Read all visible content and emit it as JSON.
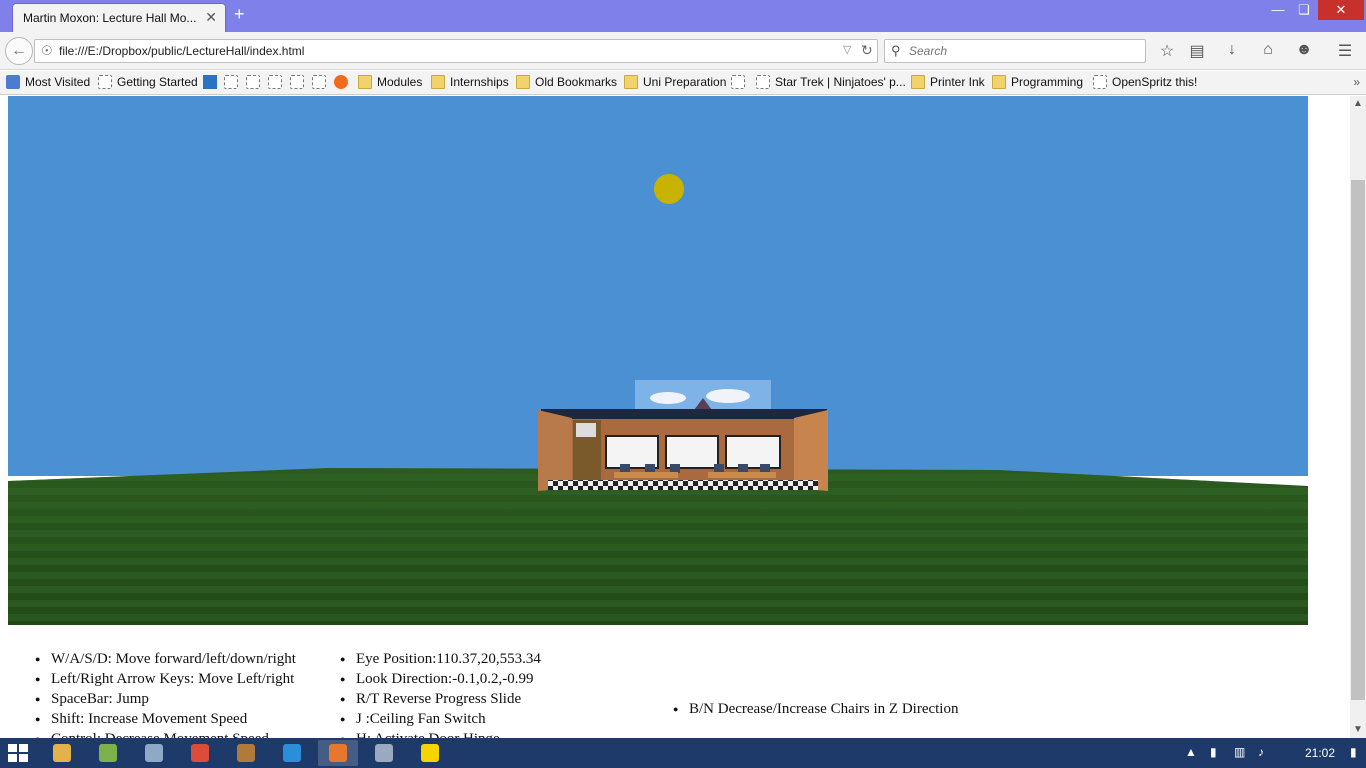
{
  "browser": {
    "tab_title": "Martin Moxon: Lecture Hall Mo...",
    "url": "file:///E:/Dropbox/public/LectureHall/index.html",
    "search_placeholder": "Search"
  },
  "bookmarks": [
    {
      "label": "Most Visited",
      "icon": "visited"
    },
    {
      "label": "Getting Started",
      "icon": "page"
    },
    {
      "label": "",
      "icon": "outlook"
    },
    {
      "label": "",
      "icon": "page"
    },
    {
      "label": "",
      "icon": "page"
    },
    {
      "label": "",
      "icon": "page"
    },
    {
      "label": "",
      "icon": "page"
    },
    {
      "label": "",
      "icon": "page"
    },
    {
      "label": "",
      "icon": "fire"
    },
    {
      "label": "Modules",
      "icon": "folder"
    },
    {
      "label": "Internships",
      "icon": "folder"
    },
    {
      "label": "Old Bookmarks",
      "icon": "folder"
    },
    {
      "label": "Uni Preparation",
      "icon": "folder"
    },
    {
      "label": "",
      "icon": "page"
    },
    {
      "label": "Star Trek | Ninjatoes' p...",
      "icon": "page"
    },
    {
      "label": "Printer Ink",
      "icon": "folder"
    },
    {
      "label": "Programming",
      "icon": "folder"
    },
    {
      "label": "OpenSpritz this!",
      "icon": "page"
    }
  ],
  "scene": {
    "sky_color": "#4a90d2",
    "grass_color": "#2f5e22",
    "sun_color": "#c8b400"
  },
  "help": {
    "col1": [
      "W/A/S/D: Move forward/left/down/right",
      "Left/Right Arrow Keys: Move Left/right",
      "SpaceBar: Jump",
      "Shift: Increase Movement Speed",
      "Control: Decrease Movement Speed"
    ],
    "col2": [
      "Eye Position:110.37,20,553.34",
      "Look Direction:-0.1,0.2,-0.99",
      "R/T Reverse Progress Slide",
      "J :Ceiling Fan Switch",
      "H: Activate Door Hinge"
    ],
    "col3": [
      "B/N Decrease/Increase Chairs in Z Direction"
    ]
  },
  "taskbar": {
    "time": "21:02",
    "apps": [
      {
        "name": "file-explorer",
        "color": "#e3b24a"
      },
      {
        "name": "notepad",
        "color": "#7db24a"
      },
      {
        "name": "remote-desktop",
        "color": "#8fa8c8"
      },
      {
        "name": "chrome",
        "color": "#dd4b39"
      },
      {
        "name": "terminal",
        "color": "#b07a3a"
      },
      {
        "name": "writer",
        "color": "#2a8fd8"
      },
      {
        "name": "firefox",
        "color": "#e8772e"
      },
      {
        "name": "paint",
        "color": "#9aa8c0"
      },
      {
        "name": "messenger",
        "color": "#f5d400"
      }
    ]
  }
}
